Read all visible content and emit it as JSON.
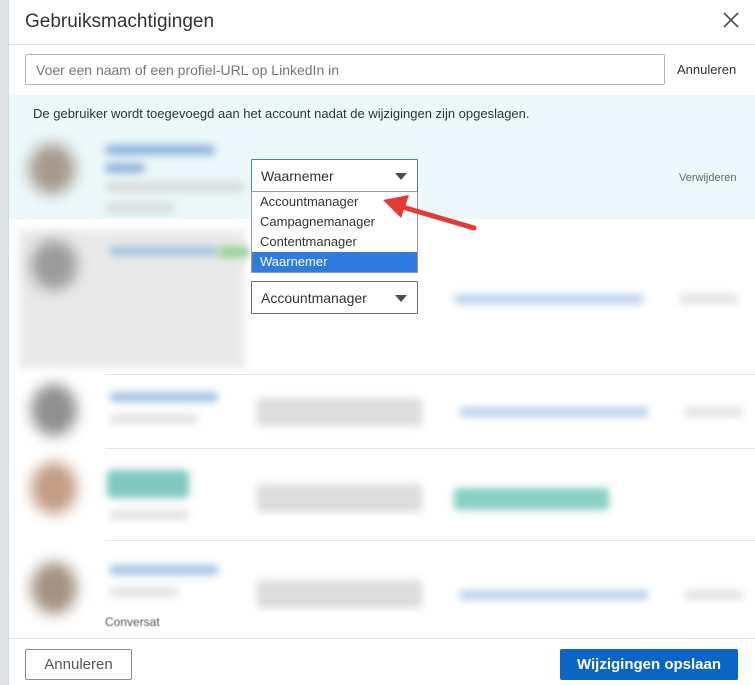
{
  "dialog": {
    "title": "Gebruiksmachtigingen"
  },
  "search": {
    "placeholder": "Voer een naam of een profiel-URL op LinkedIn in",
    "value": "",
    "cancel_label": "Annuleren"
  },
  "info": {
    "text": "De gebruiker wordt toegevoegd aan het account nadat de wijzigingen zijn opgeslagen."
  },
  "new_user_row": {
    "role_selected": "Waarnemer",
    "remove_label": "Verwijderen",
    "dropdown_options": [
      "Accountmanager",
      "Campagnemanager",
      "Contentmanager",
      "Waarnemer"
    ],
    "dropdown_highlighted": "Waarnemer"
  },
  "existing_rows": [
    {
      "role": "Accountmanager"
    }
  ],
  "peek_text": "Conversat",
  "footer": {
    "cancel_label": "Annuleren",
    "save_label": "Wijzigingen opslaan"
  },
  "colors": {
    "primary": "#0a66c2",
    "info_band": "#ebf7f8",
    "dropdown_highlight": "#2f7ce0",
    "annotation_arrow": "#e53935"
  },
  "icons": {
    "close": "close-icon",
    "caret": "chevron-down-icon",
    "annotation": "arrow-annotation-icon"
  }
}
